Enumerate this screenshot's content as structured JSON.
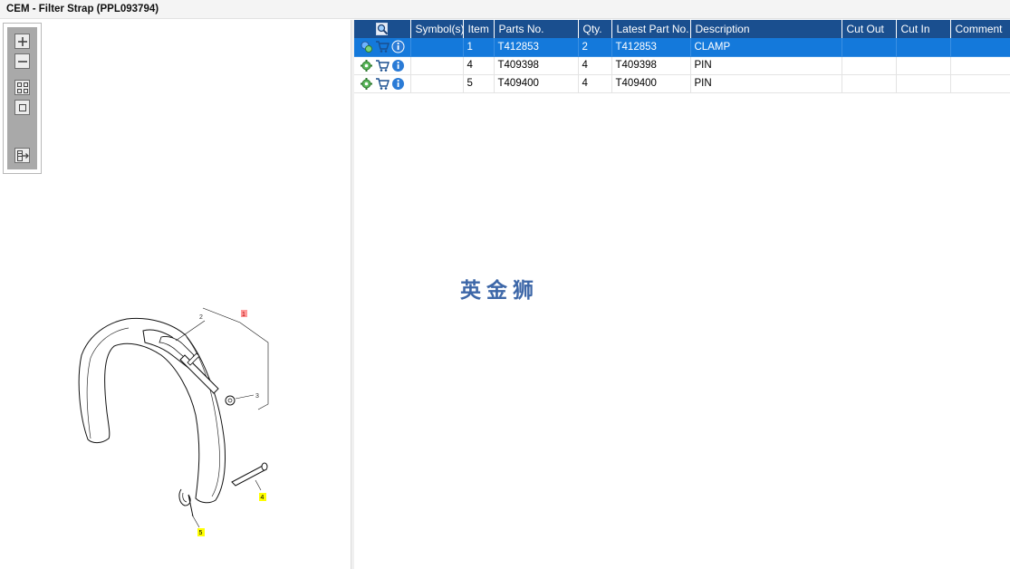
{
  "window": {
    "title": "CEM - Filter Strap (PPL093794)"
  },
  "toolbox": {
    "tools": [
      {
        "icon": "zoom-in-icon"
      },
      {
        "icon": "zoom-out-icon"
      },
      {
        "icon": "fit-all-icon"
      },
      {
        "icon": "actual-size-icon"
      },
      {
        "icon": "export-icon"
      }
    ]
  },
  "diagram": {
    "callouts": [
      "1",
      "2",
      "3",
      "4",
      "5"
    ],
    "highlight_color": "#ffff00",
    "callout1_color": "#ff9a9a"
  },
  "table": {
    "headers": {
      "symbols": "Symbol(s)",
      "item": "Item",
      "parts_no": "Parts No.",
      "qty": "Qty.",
      "latest_part_no": "Latest Part No.",
      "description": "Description",
      "cut_out": "Cut Out",
      "cut_in": "Cut In",
      "comment": "Comment"
    },
    "rows": [
      {
        "item": "1",
        "parts_no": "T412853",
        "qty": "2",
        "latest_part_no": "T412853",
        "description": "CLAMP",
        "cut_out": "",
        "cut_in": "",
        "comment": "",
        "selected": true
      },
      {
        "item": "4",
        "parts_no": "T409398",
        "qty": "4",
        "latest_part_no": "T409398",
        "description": "PIN",
        "cut_out": "",
        "cut_in": "",
        "comment": "",
        "selected": false
      },
      {
        "item": "5",
        "parts_no": "T409400",
        "qty": "4",
        "latest_part_no": "T409400",
        "description": "PIN",
        "cut_out": "",
        "cut_in": "",
        "comment": "",
        "selected": false
      }
    ]
  },
  "watermark": "英金狮",
  "colors": {
    "header": "#1a4f8f",
    "selected_row": "#1479db",
    "watermark": "#3d67a8"
  }
}
